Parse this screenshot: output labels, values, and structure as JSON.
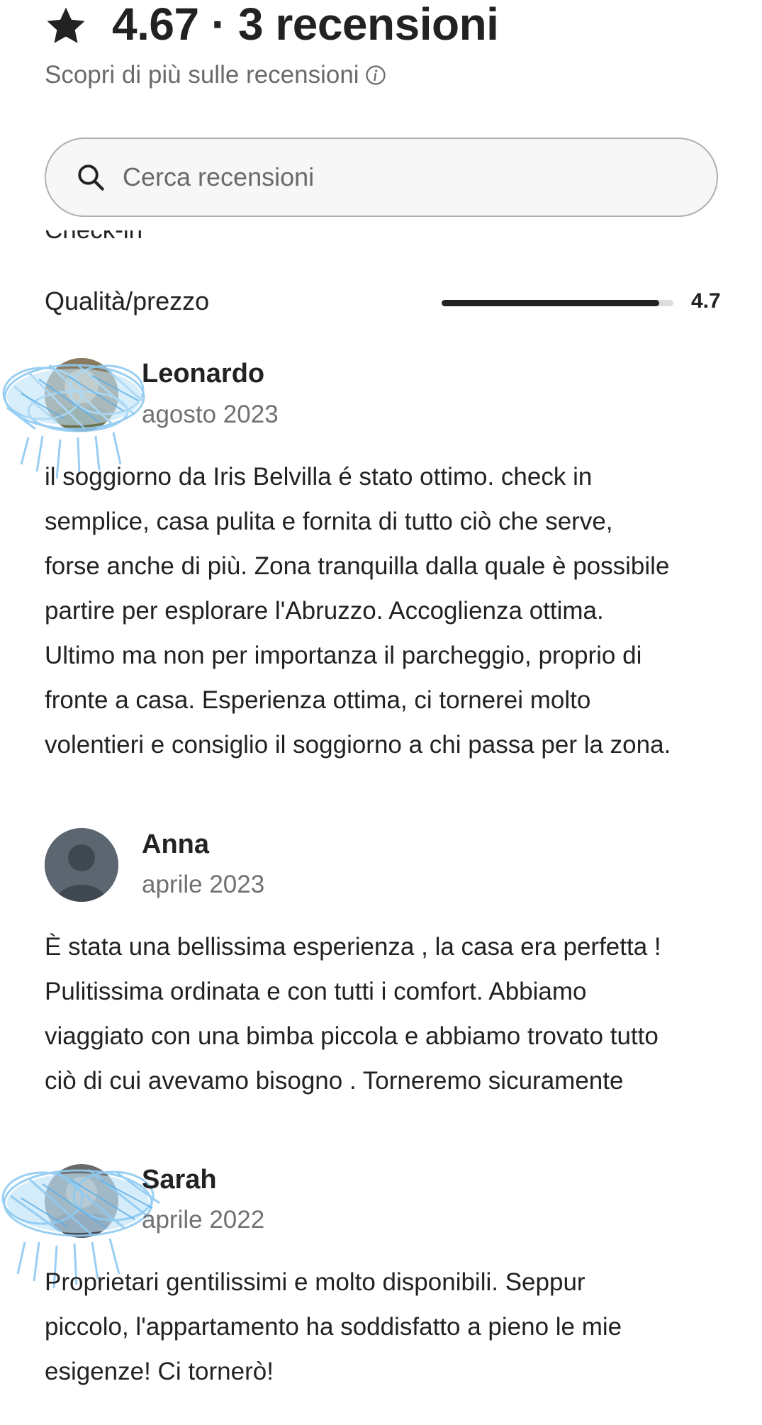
{
  "header": {
    "title": "4.67 · 3 recensioni",
    "subtitle": "Scopri di più sulle recensioni",
    "star_icon": "star-icon",
    "info_icon": "info-icon"
  },
  "search": {
    "placeholder": "Cerca recensioni",
    "icon": "search-icon"
  },
  "partial_row": {
    "label": "Check-in"
  },
  "rating_row": {
    "label": "Qualità/prezzo",
    "value": "4.7",
    "fraction": 0.94
  },
  "reviews": [
    {
      "name": "Leonardo",
      "date": "agosto 2023",
      "lines": [
        "il soggiorno da Iris Belvilla é stato ottimo. check in",
        "semplice, casa pulita e fornita di tutto ciò che serve,",
        "forse anche di più. Zona tranquilla dalla quale è possibile",
        "partire per esplorare l'Abruzzo. Accoglienza ottima.",
        "Ultimo ma non per importanza il parcheggio, proprio di",
        "fronte a casa. Esperienza ottima, ci tornerei molto",
        "volentieri e consiglio il soggiorno a chi passa per la zona."
      ]
    },
    {
      "name": "Anna",
      "date": "aprile 2023",
      "lines": [
        "È stata una bellissima esperienza , la casa era perfetta !",
        "Pulitissima ordinata e con tutti i comfort. Abbiamo",
        "viaggiato con una bimba piccola e abbiamo trovato tutto",
        "ciò di cui avevamo bisogno . Torneremo sicuramente"
      ]
    },
    {
      "name": "Sarah",
      "date": "aprile 2022",
      "lines": [
        "Proprietari gentilissimi e molto disponibili. Seppur",
        "piccolo, l'appartamento ha soddisfatto a pieno le mie",
        "esigenze! Ci tornerò!"
      ]
    }
  ],
  "colors": {
    "text": "#222222",
    "muted": "#717171",
    "scribble": "#9ed3f5",
    "avatar_default": "#5b6670"
  }
}
